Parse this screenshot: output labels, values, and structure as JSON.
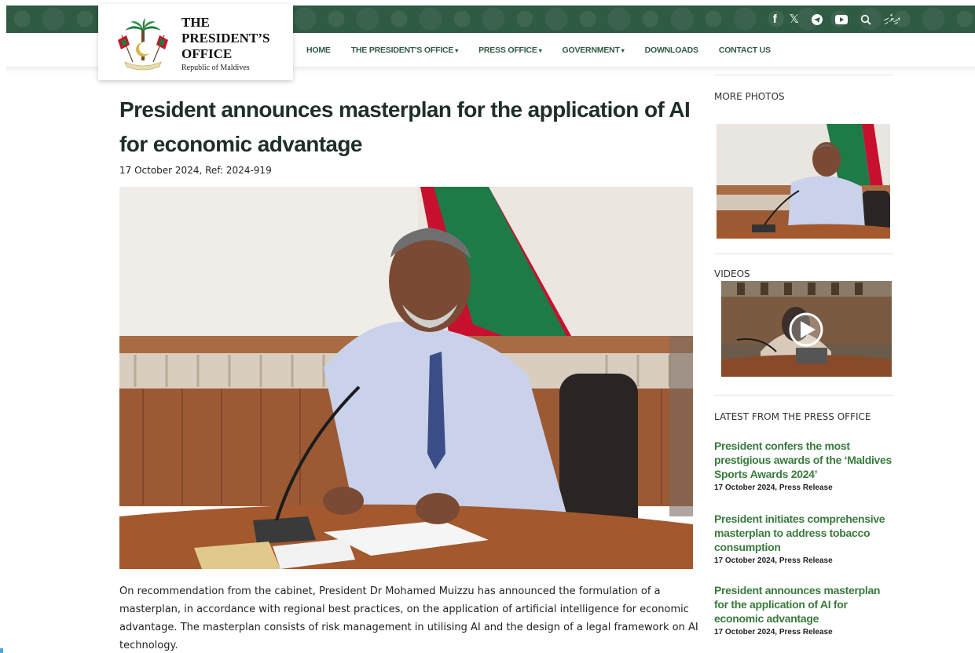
{
  "topbar": {
    "icons": [
      "facebook-icon",
      "x-icon",
      "telegram-icon",
      "youtube-icon",
      "search-icon"
    ],
    "language_label": "ދިވެހި",
    "band_color": "#2f5a44"
  },
  "logo": {
    "line1": "THE",
    "line2": "PRESIDENT’S",
    "line3": "OFFICE",
    "line4": "Republic of Maldives"
  },
  "nav": {
    "items": [
      {
        "label": "HOME",
        "dropdown": false
      },
      {
        "label": "THE PRESIDENT'S OFFICE",
        "dropdown": true
      },
      {
        "label": "PRESS OFFICE",
        "dropdown": true
      },
      {
        "label": "GOVERNMENT",
        "dropdown": true
      },
      {
        "label": "DOWNLOADS",
        "dropdown": false
      },
      {
        "label": "CONTACT US",
        "dropdown": false
      }
    ],
    "caret": "▾"
  },
  "article": {
    "title": "President announces masterplan for the application of AI for economic advantage",
    "meta": "17 October 2024, Ref: 2024-919",
    "body": "On recommendation from the cabinet, President Dr Mohamed Muizzu has announced the formulation of a masterplan, in accordance with regional best practices, on the application of artificial intelligence for economic advantage. The masterplan consists of risk management in utilising AI and the design of a legal framework on AI technology."
  },
  "sidebar": {
    "more_photos_label": "MORE PHOTOS",
    "videos_label": "VIDEOS",
    "latest_label": "LATEST FROM THE PRESS OFFICE",
    "news": [
      {
        "headline": "President confers the most prestigious awards of the ‘Maldives Sports Awards 2024’",
        "date": "17 October 2024, Press Release"
      },
      {
        "headline": "President initiates comprehensive masterplan to address tobacco consumption",
        "date": "17 October 2024, Press Release"
      },
      {
        "headline": "President announces masterplan for the application of AI for economic advantage",
        "date": "17 October 2024, Press Release"
      }
    ]
  },
  "colors": {
    "accent_green": "#2f5a44",
    "link_green": "#3a7a3e"
  }
}
